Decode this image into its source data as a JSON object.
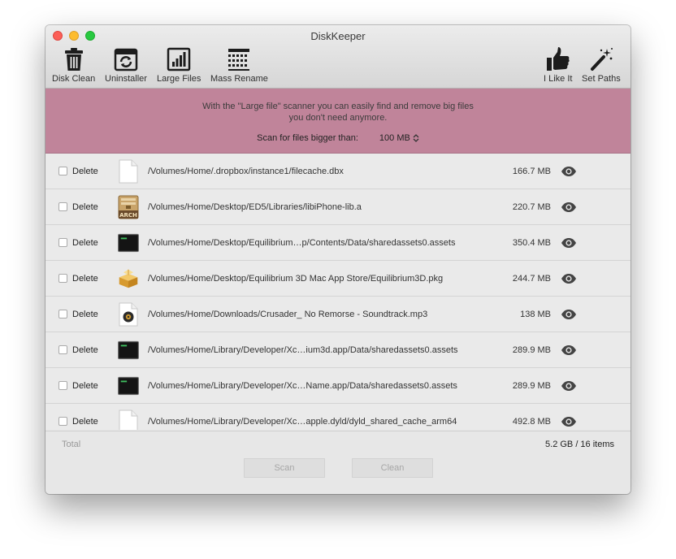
{
  "window": {
    "title": "DiskKeeper"
  },
  "toolbar": {
    "disk_clean": "Disk Clean",
    "uninstaller": "Uninstaller",
    "large_files": "Large Files",
    "mass_rename": "Mass Rename",
    "like": "I Like It",
    "set_paths": "Set Paths"
  },
  "banner": {
    "line1": "With the \"Large file\" scanner you can easily find and remove big files",
    "line2": "you don't need anymore.",
    "scan_label": "Scan for files bigger than:",
    "scan_value": "100 MB"
  },
  "files": [
    {
      "delete_label": "Delete",
      "icon": "document-icon",
      "path": "/Volumes/Home/.dropbox/instance1/filecache.dbx",
      "size": "166.7 MB"
    },
    {
      "delete_label": "Delete",
      "icon": "archive-icon",
      "path": "/Volumes/Home/Desktop/ED5/Libraries/libiPhone-lib.a",
      "size": "220.7 MB"
    },
    {
      "delete_label": "Delete",
      "icon": "terminal-file-icon",
      "path": "/Volumes/Home/Desktop/Equilibrium…p/Contents/Data/sharedassets0.assets",
      "size": "350.4 MB"
    },
    {
      "delete_label": "Delete",
      "icon": "package-icon",
      "path": "/Volumes/Home/Desktop/Equilibrium 3D Mac App Store/Equilibrium3D.pkg",
      "size": "244.7 MB"
    },
    {
      "delete_label": "Delete",
      "icon": "audio-file-icon",
      "path": "/Volumes/Home/Downloads/Crusader_ No Remorse - Soundtrack.mp3",
      "size": "138 MB"
    },
    {
      "delete_label": "Delete",
      "icon": "terminal-file-icon",
      "path": "/Volumes/Home/Library/Developer/Xc…ium3d.app/Data/sharedassets0.assets",
      "size": "289.9 MB"
    },
    {
      "delete_label": "Delete",
      "icon": "terminal-file-icon",
      "path": "/Volumes/Home/Library/Developer/Xc…Name.app/Data/sharedassets0.assets",
      "size": "289.9 MB"
    },
    {
      "delete_label": "Delete",
      "icon": "document-icon",
      "path": "/Volumes/Home/Library/Developer/Xc…apple.dyld/dyld_shared_cache_arm64",
      "size": "492.8 MB"
    }
  ],
  "footer": {
    "total_label": "Total",
    "summary": "5.2 GB / 16 items",
    "scan_button": "Scan",
    "clean_button": "Clean"
  },
  "colors": {
    "banner": "#c0849a",
    "window_bg": "#e7e7e7"
  }
}
